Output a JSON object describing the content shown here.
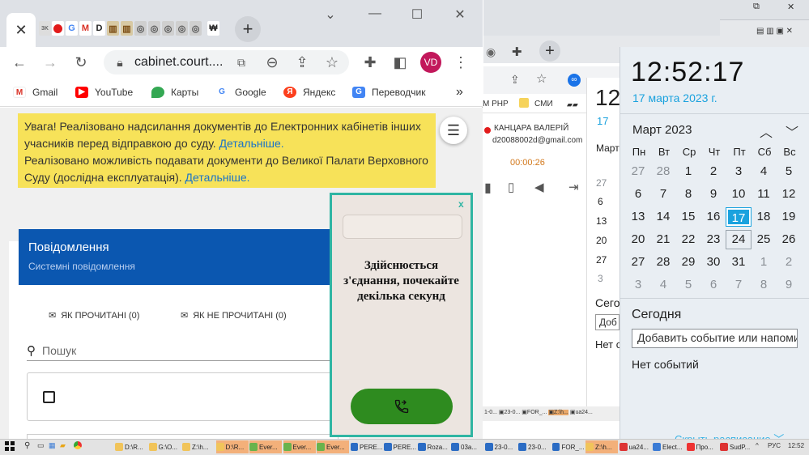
{
  "chrome": {
    "tab_close": "✕",
    "url": "cabinet.court....",
    "avatar": "VD",
    "bookmarks": [
      "Gmail",
      "YouTube",
      "Карты",
      "Google",
      "Яндекс",
      "Переводчик"
    ],
    "more_bookmarks": "»"
  },
  "notice": {
    "line1": "Увага! Реалізовано надсилання документів до Електронних кабінетів інших учасників перед відправкою до суду. ",
    "link1": "Детальніше.",
    "line2": "Реалізовано можливість подавати документи до Великої Палати Верховного Суду (дослідна експлуатація). ",
    "link2": "Детальніше."
  },
  "messages": {
    "title": "Повідомлення",
    "subtitle": "Системні повідомлення",
    "filter_read": "ЯК ПРОЧИТАНІ (0)",
    "filter_unread": "ЯК НЕ ПРОЧИТАНІ (0)",
    "search_placeholder": "Пошук"
  },
  "popup": {
    "close": "x",
    "message": "Здійснюється з'єднання, почекайте декілька секунд"
  },
  "background_window": {
    "bookmarks": [
      "М РНР",
      "СМИ"
    ],
    "contact_name": "КАНЦАРА ВАЛЕРІЙ",
    "contact_email": "d20088002d@gmail.com",
    "timer": "00:00:26",
    "partial_big": "12",
    "partial_mid": "17",
    "partial_month": "Март",
    "partial_days": [
      "27",
      "6",
      "13",
      "20",
      "27",
      "3"
    ],
    "partial_labels": [
      "Сегод",
      "Доб",
      "Нет со"
    ]
  },
  "clock": {
    "time": "12:52:17",
    "date": "17 марта 2023 г.",
    "month": "Март 2023",
    "weekdays": [
      "Пн",
      "Вт",
      "Ср",
      "Чт",
      "Пт",
      "Сб",
      "Вс"
    ],
    "weeks": [
      [
        "27",
        "28",
        "1",
        "2",
        "3",
        "4",
        "5"
      ],
      [
        "6",
        "7",
        "8",
        "9",
        "10",
        "11",
        "12"
      ],
      [
        "13",
        "14",
        "15",
        "16",
        "17",
        "18",
        "19"
      ],
      [
        "20",
        "21",
        "22",
        "23",
        "24",
        "25",
        "26"
      ],
      [
        "27",
        "28",
        "29",
        "30",
        "31",
        "1",
        "2"
      ],
      [
        "3",
        "4",
        "5",
        "6",
        "7",
        "8",
        "9"
      ]
    ],
    "today_label": "Сегодня",
    "add_event": "Добавить событие или напоминание",
    "no_events": "Нет событий",
    "hide_schedule": "Скрыть расписание"
  },
  "taskbar": {
    "items": [
      "D:\\R...",
      "G:\\O...",
      "Z:\\h...",
      "D:\\R...",
      "Ever...",
      "Ever...",
      "Ever...",
      "PERE...",
      "PERE...",
      "Roza...",
      "03a...",
      "23-0...",
      "23-0...",
      "FOR_...",
      "Z:\\h...",
      "ua24...",
      "Elect...",
      "Про...",
      "SudP..."
    ],
    "lang": "РУС",
    "time": "12:52"
  }
}
